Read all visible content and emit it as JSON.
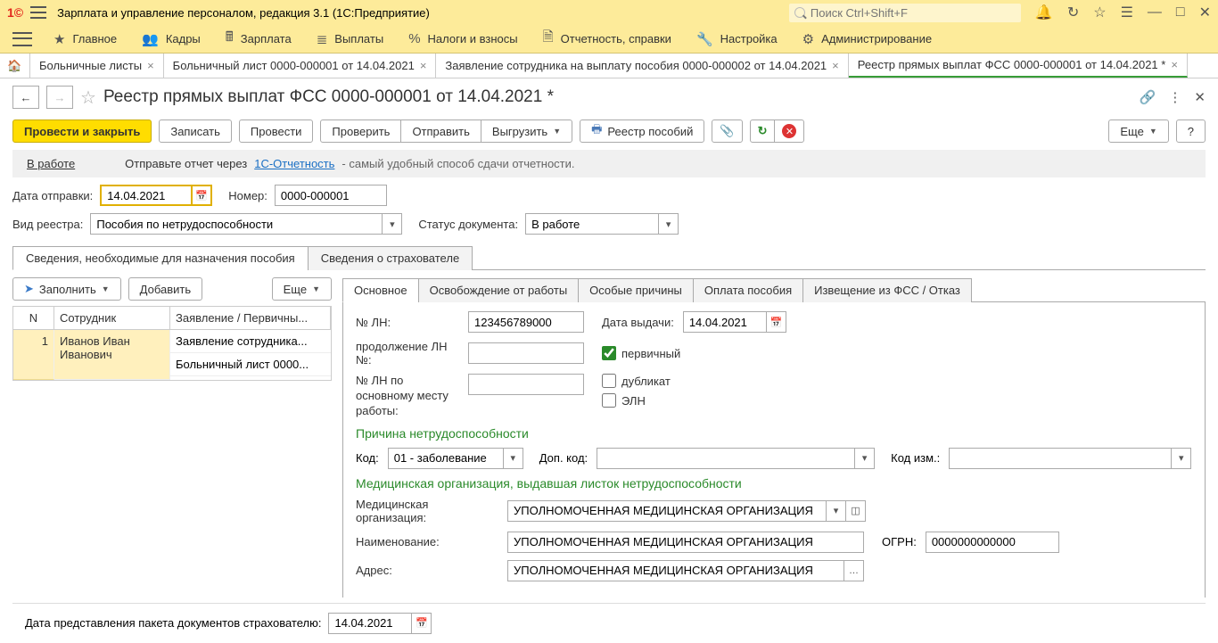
{
  "titlebar": {
    "app": "Зарплата и управление персоналом, редакция 3.1  (1С:Предприятие)",
    "search_placeholder": "Поиск Ctrl+Shift+F"
  },
  "mainmenu": [
    "Главное",
    "Кадры",
    "Зарплата",
    "Выплаты",
    "Налоги и взносы",
    "Отчетность, справки",
    "Настройка",
    "Администрирование"
  ],
  "doctabs": {
    "t0": "Больничные листы",
    "t1": "Больничный лист 0000-000001 от 14.04.2021",
    "t2": "Заявление сотрудника на выплату пособия 0000-000002 от 14.04.2021",
    "t3": "Реестр прямых выплат ФСС 0000-000001 от 14.04.2021 *"
  },
  "page": {
    "title": "Реестр прямых выплат ФСС 0000-000001 от 14.04.2021 *"
  },
  "cmd": {
    "post_close": "Провести и закрыть",
    "save": "Записать",
    "post": "Провести",
    "check": "Проверить",
    "send": "Отправить",
    "export": "Выгрузить",
    "registry": "Реестр пособий",
    "more": "Еще",
    "help": "?"
  },
  "info": {
    "status": "В работе",
    "prefix": "Отправьте отчет через ",
    "link": "1С-Отчетность",
    "suffix": " - самый удобный способ сдачи отчетности."
  },
  "form": {
    "send_date_label": "Дата отправки:",
    "send_date": "14.04.2021",
    "number_label": "Номер:",
    "number": "0000-000001",
    "kind_label": "Вид реестра:",
    "kind": "Пособия по нетрудоспособности",
    "status_label": "Статус документа:",
    "status": "В работе"
  },
  "tabs": {
    "t0": "Сведения, необходимые для назначения пособия",
    "t1": "Сведения о страхователе"
  },
  "leftcmd": {
    "fill": "Заполнить",
    "add": "Добавить",
    "more": "Еще"
  },
  "grid": {
    "h_n": "N",
    "h_emp": "Сотрудник",
    "h_doc": "Заявление / Первичны...",
    "r1_n": "1",
    "r1_emp": "Иванов Иван Иванович",
    "r1_d1": "Заявление сотрудника...",
    "r1_d2": "Больничный лист 0000..."
  },
  "subtabs": {
    "s0": "Основное",
    "s1": "Освобождение от работы",
    "s2": "Особые причины",
    "s3": "Оплата пособия",
    "s4": "Извещение из ФСС / Отказ"
  },
  "rf": {
    "ln_label": "№ ЛН:",
    "ln": "123456789000",
    "issue_label": "Дата выдачи:",
    "issue": "14.04.2021",
    "cont_label": "продолжение ЛН №:",
    "primary": "первичный",
    "dup": "дубликат",
    "eln": "ЭЛН",
    "mainplace_label": "№ ЛН по основному месту работы:",
    "reason_title": "Причина нетрудоспособности",
    "code_label": "Код:",
    "code": "01 - заболевание",
    "addcode_label": "Доп. код:",
    "codechg_label": "Код изм.:",
    "med_title": "Медицинская организация, выдавшая листок нетрудоспособности",
    "medorg_label": "Медицинская организация:",
    "medorg": "УПОЛНОМОЧЕННАЯ МЕДИЦИНСКАЯ ОРГАНИЗАЦИЯ",
    "name_label": "Наименование:",
    "name": "УПОЛНОМОЧЕННАЯ МЕДИЦИНСКАЯ ОРГАНИЗАЦИЯ",
    "ogrn_label": "ОГРН:",
    "ogrn": "0000000000000",
    "addr_label": "Адрес:",
    "addr": "УПОЛНОМОЧЕННАЯ МЕДИЦИНСКАЯ ОРГАНИЗАЦИЯ"
  },
  "bottom": {
    "label": "Дата представления пакета документов страхователю:",
    "date": "14.04.2021"
  }
}
